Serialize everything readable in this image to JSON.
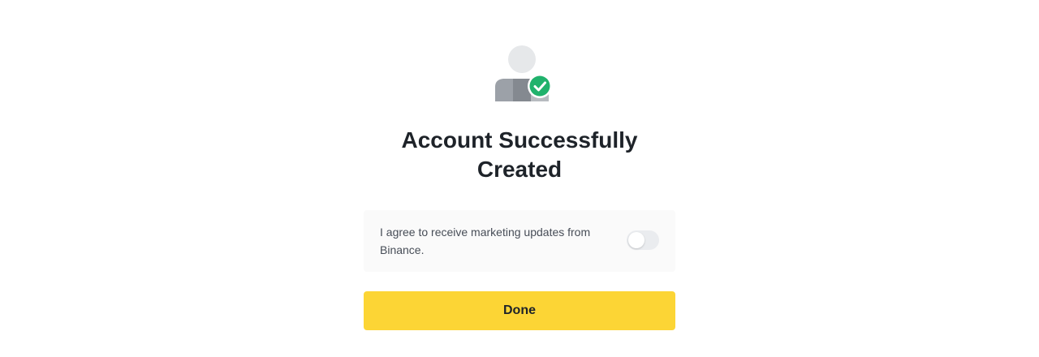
{
  "success": {
    "icon": "user-verified-icon",
    "title_line1": "Account Successfully",
    "title_line2": "Created"
  },
  "consent": {
    "text": "I agree to receive marketing updates from Binance.",
    "toggle_state": "off"
  },
  "done_button": {
    "label": "Done"
  },
  "colors": {
    "accent": "#FCD535",
    "success": "#20B26C",
    "text_primary": "#1E2329",
    "text_secondary": "#474D57",
    "consent_background": "#FAFAFA",
    "toggle_track": "#EAECEF"
  }
}
